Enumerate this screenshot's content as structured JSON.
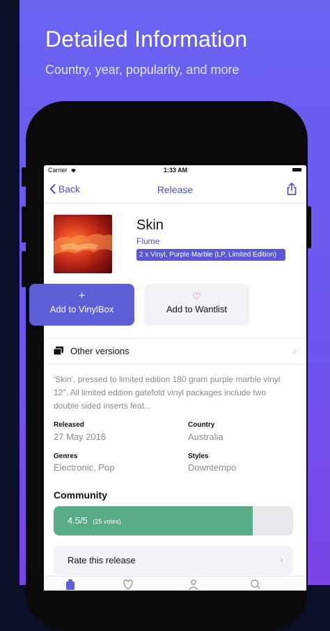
{
  "promo": {
    "title": "Detailed Information",
    "subtitle": "Country, year, popularity, and more"
  },
  "status_bar": {
    "carrier": "Carrier",
    "time": "1:33 AM"
  },
  "nav": {
    "back_label": "Back",
    "title": "Release",
    "share_icon": "share-icon"
  },
  "release": {
    "title": "Skin",
    "artist": "Flume",
    "format": "2 x Vinyl, Purple Marble (LP, Limited Edition)"
  },
  "actions": {
    "add_vinylbox_icon": "+",
    "add_vinylbox_label": "Add to VinylBox",
    "add_wantlist_icon": "♡",
    "add_wantlist_label": "Add to Wantlist"
  },
  "other_versions": {
    "label": "Other versions",
    "chevron": "›"
  },
  "description": "'Skin', pressed to limited edition 180 gram purple marble vinyl 12\". All limited edition gatefold vinyl packages include two double sided inserts feat...",
  "details": {
    "released_label": "Released",
    "released_value": "27 May 2016",
    "country_label": "Country",
    "country_value": "Australia",
    "genres_label": "Genres",
    "genres_value": "Electronic, Pop",
    "styles_label": "Styles",
    "styles_value": "Downtempo"
  },
  "community": {
    "title": "Community",
    "rating_text": "4.5/5",
    "votes_text": "(25 votes)",
    "rating_fraction": 0.83
  },
  "rate": {
    "label": "Rate this release",
    "chevron": "›"
  },
  "tabs": [
    "collection-icon",
    "heart-icon",
    "profile-icon",
    "search-icon"
  ],
  "colors": {
    "accent": "#4d4fc7",
    "primary_button": "#5e5ed8",
    "rating_fill": "#57ac86",
    "heart": "#e5484d",
    "promo_gradient_top": "#6a63f0",
    "promo_gradient_bottom": "#7a45e6"
  }
}
